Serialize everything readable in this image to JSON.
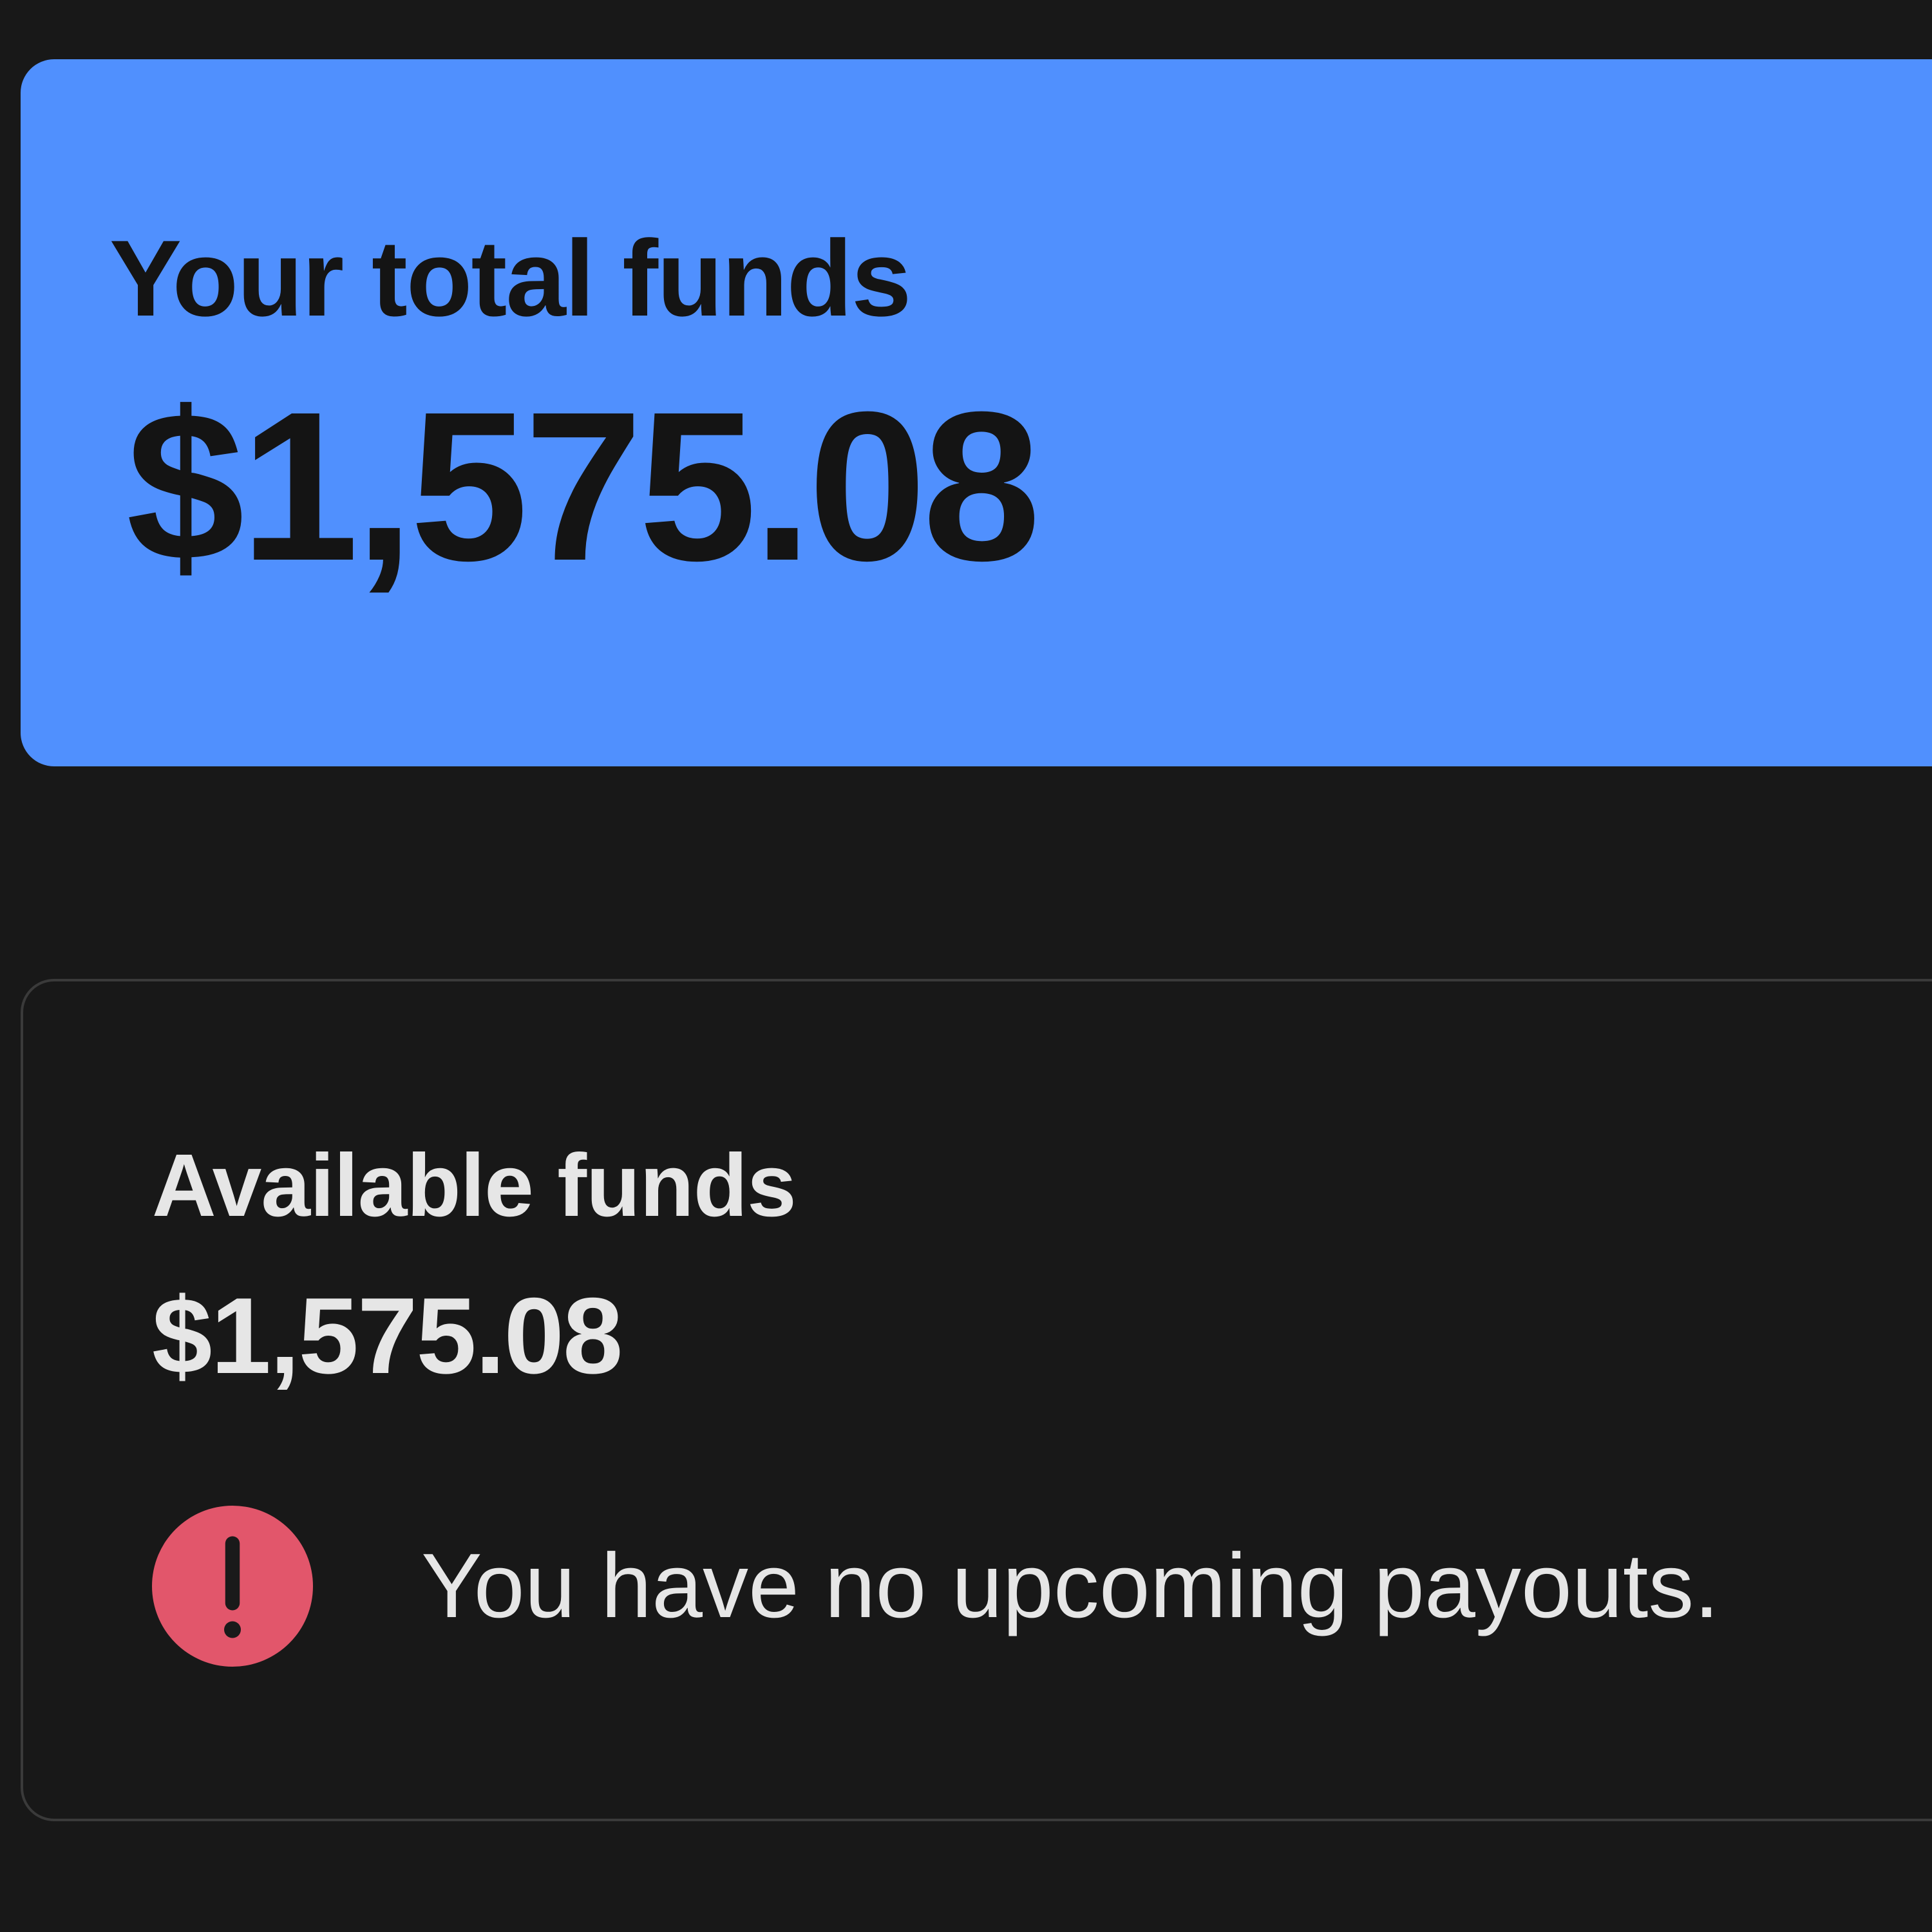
{
  "total_funds": {
    "label": "Your total funds",
    "amount": "$1,575.08"
  },
  "available_funds": {
    "label": "Available funds",
    "amount": "$1,575.08"
  },
  "payout_notice": {
    "icon": "alert-circle-icon",
    "message": "You have no upcoming payouts."
  },
  "colors": {
    "background": "#181818",
    "total_card": "#5090fe",
    "alert": "#e2566b",
    "text_light": "#e6e6e6",
    "text_dark": "#141414"
  }
}
